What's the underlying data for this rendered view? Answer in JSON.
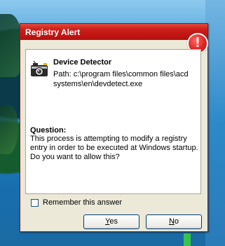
{
  "window": {
    "title": "Registry Alert",
    "alert_icon_glyph": "!"
  },
  "device": {
    "name": "Device Detector",
    "path": "Path: c:\\program files\\common files\\acd systems\\en\\devdetect.exe",
    "icon": "camera-icon"
  },
  "question": {
    "heading": "Question:",
    "text": "This process is attempting to modify a registry entry in order to be executed at Windows startup. Do you want to allow this?"
  },
  "remember": {
    "label": "Remember this answer",
    "checked": false
  },
  "buttons": {
    "yes_mnemonic": "Y",
    "yes_rest": "es",
    "no_mnemonic": "N",
    "no_rest": "o"
  },
  "colors": {
    "titlebar": "#cc1e1a",
    "alert_icon": "#e02424",
    "dialog_bg": "#ece9d8"
  }
}
